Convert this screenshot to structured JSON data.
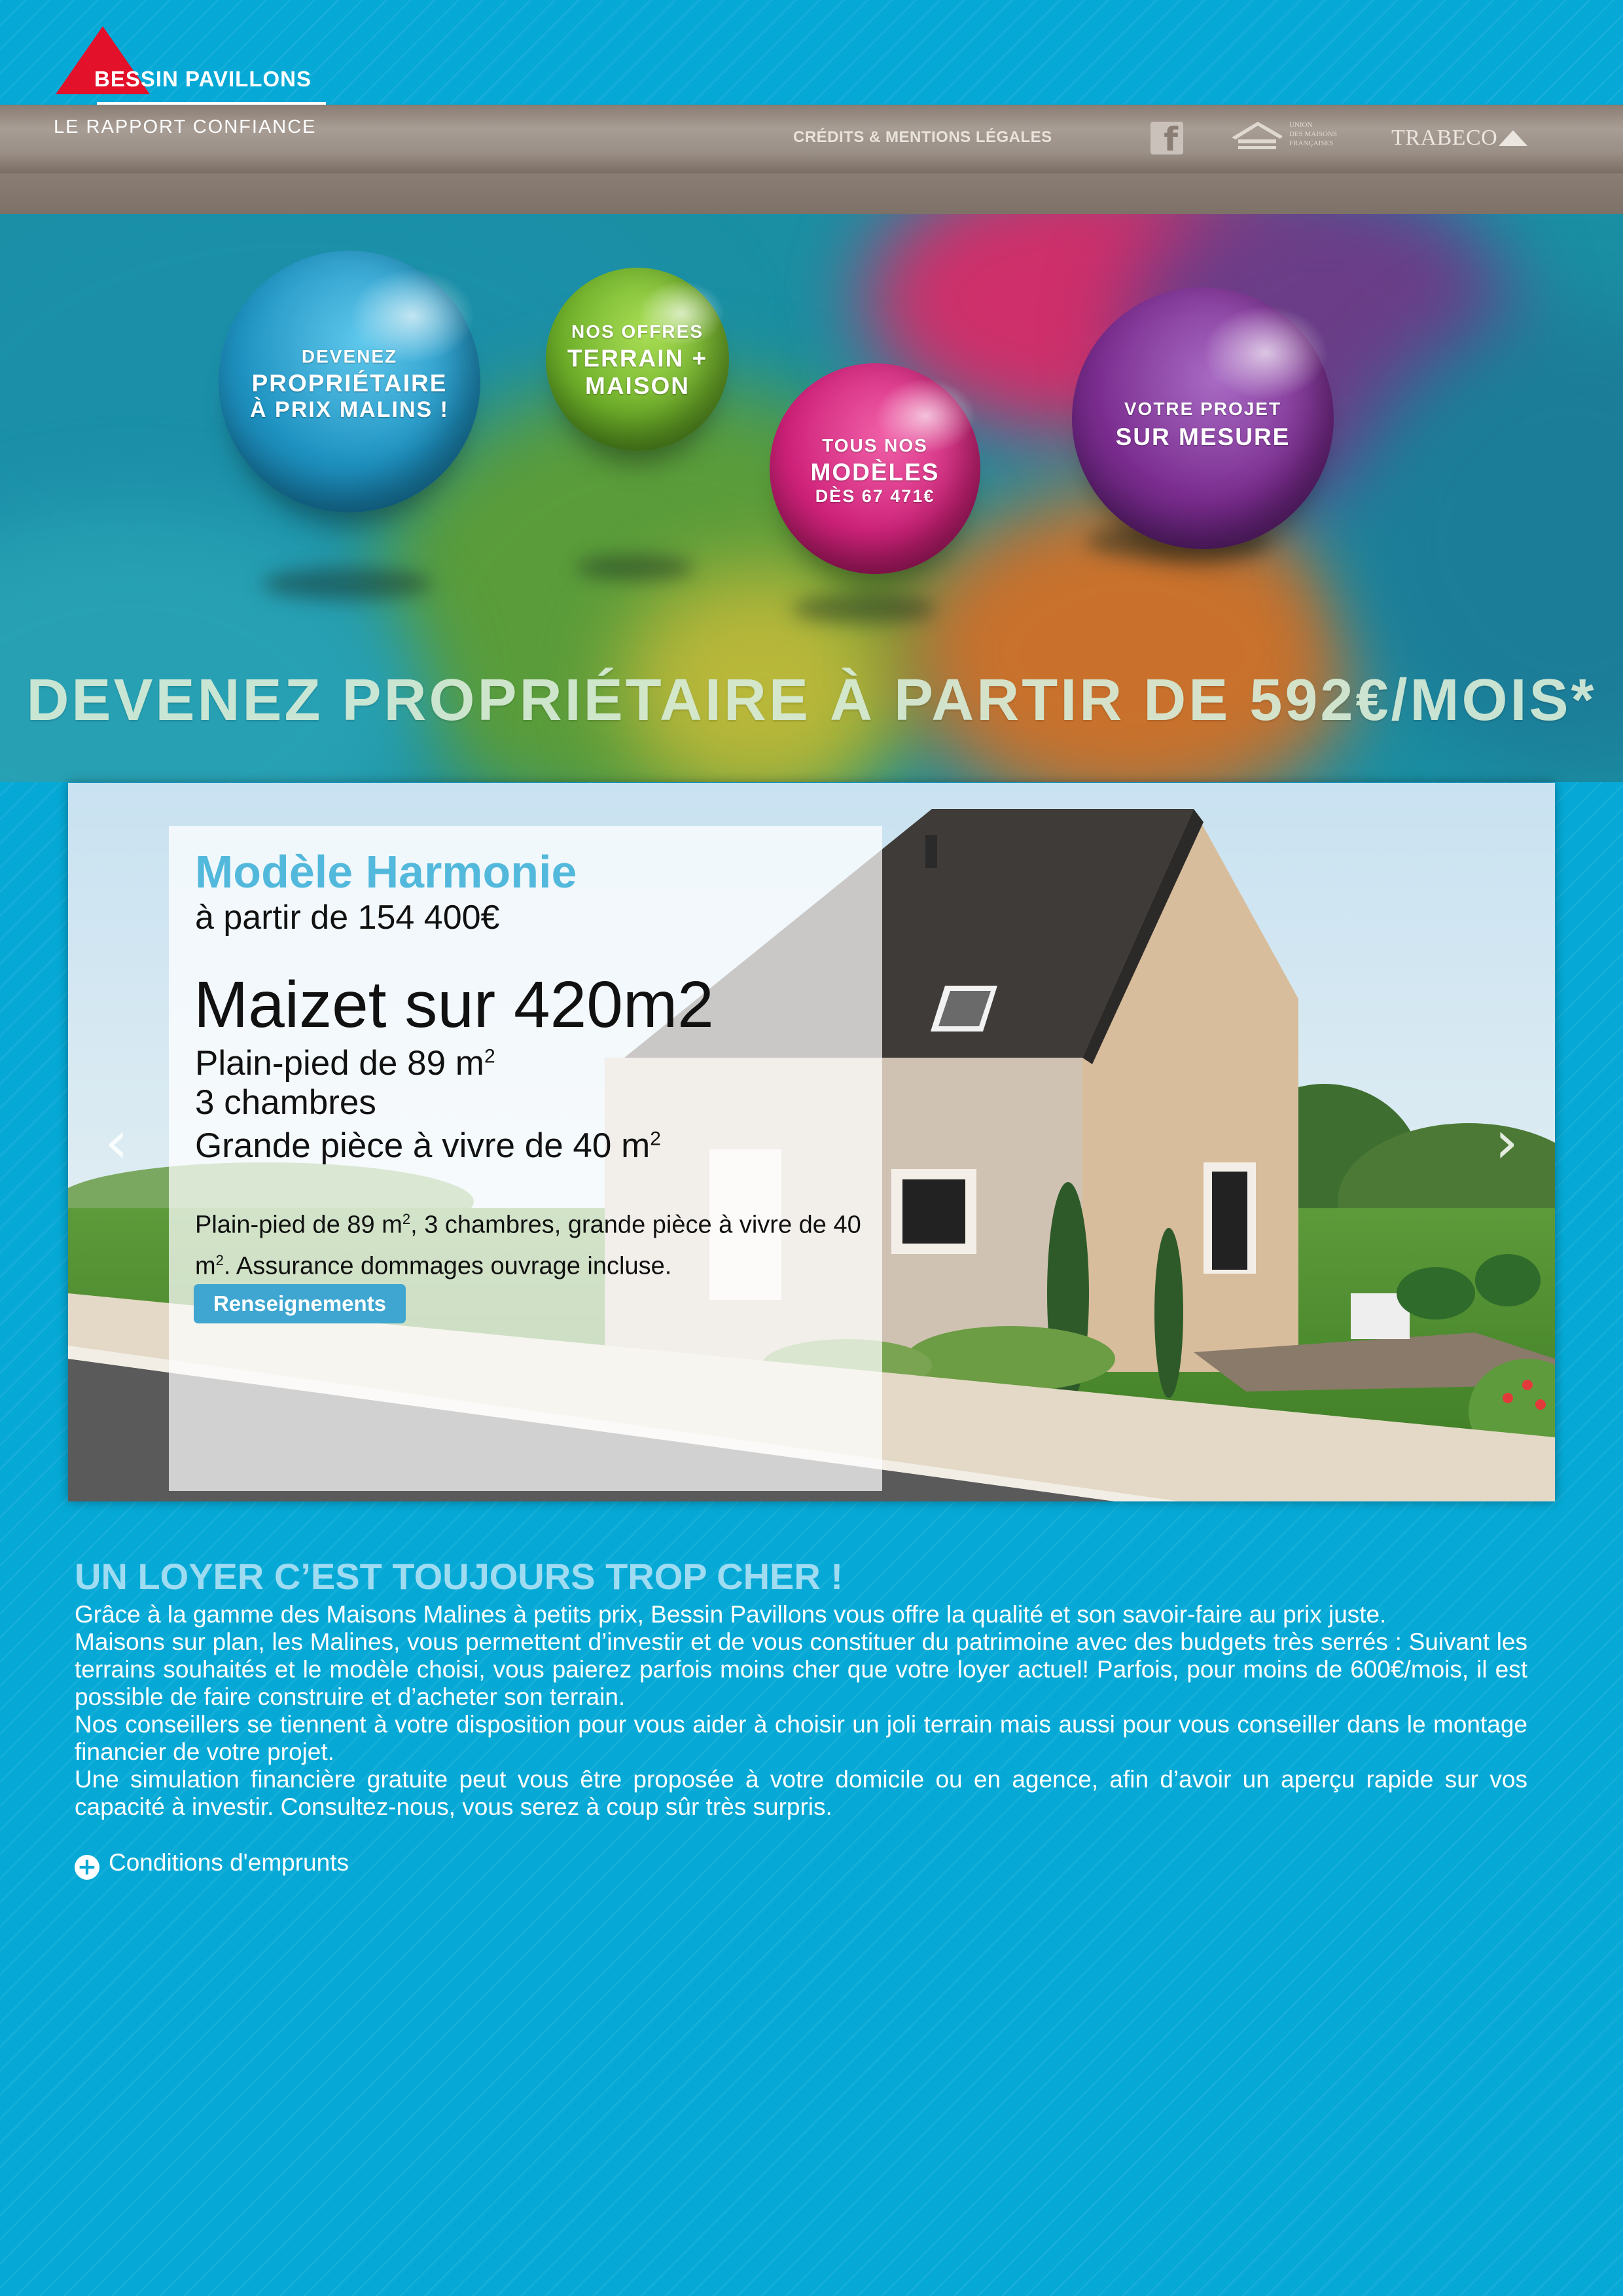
{
  "header": {
    "brand": "BESSIN PAVILLONS",
    "tagline": "LE RAPPORT CONFIANCE",
    "credits_link": "CRÉDITS & MENTIONS LÉGALES",
    "umf_logo_text": [
      "UNION",
      "DES MAISONS",
      "FRANÇAISES"
    ],
    "trabeco": "TRABECO",
    "icons": [
      "house-roof-logo-icon",
      "facebook-icon",
      "umf-house-icon",
      "trabeco-triangle-icon"
    ]
  },
  "hero": {
    "bubbles": [
      {
        "small": "DEVENEZ",
        "big1": "PROPRIÉTAIRE",
        "big2": "À PRIX MALINS !",
        "color": "#2aa3d3"
      },
      {
        "small": "NOS OFFRES",
        "big1": "TERRAIN +",
        "big2": "MAISON",
        "color": "#78b82a"
      },
      {
        "small": "TOUS NOS",
        "big1": "MODÈLES",
        "big2": "DÈS 67 471€",
        "color": "#d6257c"
      },
      {
        "small": "VOTRE PROJET",
        "big1": "SUR MESURE",
        "big2": "",
        "color": "#7a2c8e"
      }
    ],
    "headline": "DEVENEZ PROPRIÉTAIRE À PARTIR DE 592€/MOIS*"
  },
  "slider": {
    "title": "Modèle Harmonie",
    "price": "à partir de 154 400€",
    "name": "Maizet sur 420m2",
    "feature1": "Plain-pied de 89 m",
    "feature1_sup": "2",
    "feature2": "3 chambres",
    "feature3": "Grande pièce à vivre de 40 m",
    "feature3_sup": "2",
    "desc_part1": "Plain-pied de 89 m",
    "desc_sup1": "2",
    "desc_part2": ", 3 chambres, grande pièce à vivre de 40 m",
    "desc_sup2": "2",
    "desc_part3": ". Assurance dommages ouvrage incluse.",
    "button": "Renseignements",
    "prev_arrow": "‹",
    "next_arrow": "›"
  },
  "content": {
    "title": "UN LOYER C’EST TOUJOURS TROP CHER !",
    "paragraphs": [
      "Grâce à la gamme des Maisons Malines à petits prix, Bessin Pavillons vous offre la qualité et son savoir-faire au prix juste.",
      "Maisons sur plan, les Malines, vous permettent d’investir et de vous constituer du patrimoine avec des budgets très serrés : Suivant les terrains souhaités et le modèle choisi, vous paierez parfois moins cher que votre loyer actuel! Parfois, pour moins de 600€/mois, il est possible de faire construire et d’acheter son terrain.",
      "Nos conseillers se tiennent à votre disposition pour vous aider à choisir un joli terrain mais aussi pour vous conseiller dans le montage financier de votre projet.",
      "Une simulation financière gratuite peut vous être proposée à votre domicile ou en agence, afin d’avoir un aperçu rapide sur vos capacité à investir. Consultez-nous, vous serez à coup sûr très surpris."
    ],
    "conditions_icon": "+",
    "conditions": "Conditions d'emprunts"
  },
  "colors": {
    "background": "#06a9d6",
    "header_band": "#9a8f86",
    "logo_red": "#e3112a",
    "title_blue": "#53b9dc",
    "button_blue": "#3ea6d0",
    "section_title": "#9fdcf2"
  }
}
